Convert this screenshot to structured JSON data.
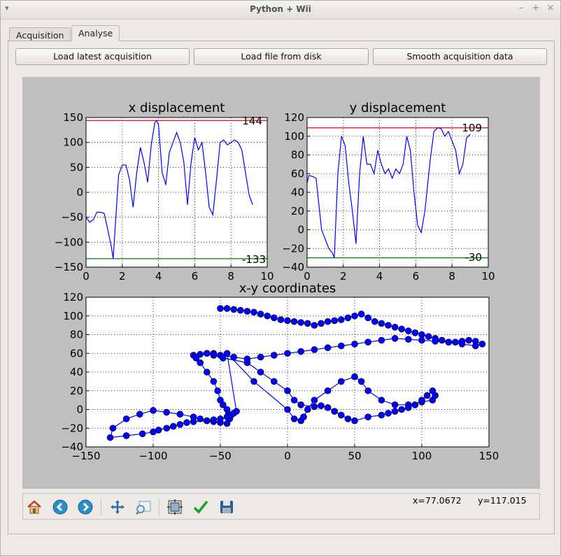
{
  "window": {
    "title": "Python + Wii"
  },
  "tabs": [
    {
      "label": "Acquisition"
    },
    {
      "label": "Analyse"
    }
  ],
  "buttons": {
    "load_latest": "Load latest acquisition",
    "load_file": "Load file from disk",
    "smooth": "Smooth acquisition data"
  },
  "toolbar": {
    "icons": [
      "home-icon",
      "back-icon",
      "forward-icon",
      "pan-icon",
      "zoom-icon",
      "subplots-icon",
      "edit-curves-icon",
      "save-icon"
    ]
  },
  "status": {
    "x": "x=77.0672",
    "y": "y=117.015"
  },
  "colors": {
    "line": "#0000ff",
    "max_line": "#ff0000",
    "min_line": "#008000",
    "marker": "#0000ff",
    "figure_bg": "#bfbfbf"
  },
  "chart_data": [
    {
      "type": "line",
      "title": "x displacement",
      "xlim": [
        0,
        10
      ],
      "ylim": [
        -150,
        150
      ],
      "xticks": [
        "0",
        "2",
        "4",
        "6",
        "8",
        "10"
      ],
      "yticks": [
        "−150",
        "−100",
        "−50",
        "0",
        "50",
        "100",
        "150"
      ],
      "grid": true,
      "max_label": "144",
      "max_value": 144,
      "min_label": "-133",
      "min_value": -133,
      "x": [
        0,
        0.2,
        0.4,
        0.6,
        0.8,
        1.0,
        1.2,
        1.4,
        1.5,
        1.7,
        1.8,
        2.0,
        2.2,
        2.4,
        2.6,
        2.8,
        3.0,
        3.2,
        3.4,
        3.6,
        3.8,
        3.9,
        4.0,
        4.2,
        4.4,
        4.6,
        4.8,
        5.0,
        5.2,
        5.4,
        5.6,
        5.8,
        6.0,
        6.2,
        6.4,
        6.6,
        6.8,
        7.0,
        7.2,
        7.4,
        7.6,
        7.8,
        8.0,
        8.2,
        8.4,
        8.6,
        8.8,
        9.0,
        9.2
      ],
      "y": [
        -50,
        -60,
        -55,
        -40,
        -40,
        -42,
        -75,
        -110,
        -133,
        -20,
        35,
        55,
        55,
        25,
        -30,
        40,
        90,
        60,
        20,
        95,
        140,
        144,
        135,
        40,
        15,
        80,
        100,
        120,
        100,
        60,
        -25,
        60,
        110,
        85,
        100,
        40,
        -30,
        -45,
        25,
        100,
        105,
        95,
        100,
        105,
        100,
        85,
        40,
        -5,
        -25
      ]
    },
    {
      "type": "line",
      "title": "y displacement",
      "xlim": [
        0,
        10
      ],
      "ylim": [
        -40,
        120
      ],
      "xticks": [
        "0",
        "2",
        "4",
        "6",
        "8",
        "10"
      ],
      "yticks": [
        "−40",
        "−20",
        "0",
        "20",
        "40",
        "60",
        "80",
        "100",
        "120"
      ],
      "grid": true,
      "max_label": "109",
      "max_value": 109,
      "min_label": "-30",
      "min_value": -30,
      "x": [
        0,
        0.1,
        0.3,
        0.5,
        0.8,
        1.0,
        1.2,
        1.4,
        1.5,
        1.7,
        1.9,
        2.1,
        2.3,
        2.5,
        2.7,
        2.9,
        3.1,
        3.3,
        3.5,
        3.7,
        3.9,
        4.1,
        4.3,
        4.5,
        4.7,
        4.9,
        5.1,
        5.3,
        5.5,
        5.7,
        5.9,
        6.1,
        6.3,
        6.5,
        6.8,
        7.0,
        7.2,
        7.4,
        7.6,
        7.8,
        8.0,
        8.2,
        8.4,
        8.6,
        8.8,
        9.0
      ],
      "y": [
        50,
        58,
        57,
        55,
        0,
        -10,
        -20,
        -25,
        -30,
        60,
        100,
        90,
        50,
        20,
        -15,
        60,
        100,
        70,
        70,
        60,
        85,
        70,
        60,
        65,
        55,
        65,
        60,
        70,
        100,
        85,
        40,
        5,
        -3,
        20,
        75,
        105,
        109,
        108,
        100,
        105,
        95,
        85,
        60,
        70,
        98,
        102
      ]
    },
    {
      "type": "scatter",
      "title": "x-y coordinates",
      "xlim": [
        -150,
        150
      ],
      "ylim": [
        -40,
        120
      ],
      "xticks": [
        "−150",
        "−100",
        "−50",
        "0",
        "50",
        "100",
        "150"
      ],
      "yticks": [
        "−40",
        "−20",
        "0",
        "20",
        "40",
        "60",
        "80",
        "100",
        "120"
      ],
      "grid": true,
      "x": [
        -50,
        -45,
        -40,
        -35,
        -30,
        -25,
        -20,
        -15,
        -10,
        -5,
        0,
        5,
        10,
        15,
        20,
        25,
        30,
        35,
        40,
        45,
        50,
        55,
        60,
        65,
        70,
        75,
        80,
        85,
        90,
        95,
        100,
        105,
        110,
        115,
        120,
        125,
        130,
        135,
        140,
        145,
        140,
        130,
        120,
        110,
        100,
        90,
        80,
        70,
        60,
        50,
        40,
        30,
        20,
        10,
        0,
        -10,
        -20,
        -30,
        -40,
        -50,
        -55,
        -60,
        -65,
        -70,
        -68,
        -65,
        -60,
        -55,
        -52,
        -50,
        -48,
        -45,
        -44,
        -43,
        -45,
        -50,
        -55,
        -60,
        -65,
        -70,
        -80,
        -90,
        -100,
        -110,
        -120,
        -130,
        -132,
        -120,
        -108,
        -100,
        -96,
        -90,
        -85,
        -80,
        -75,
        -70,
        -60,
        -55,
        -50,
        -45,
        -42,
        -40,
        -38,
        -45,
        -25,
        0,
        5,
        10,
        12,
        15,
        20,
        30,
        40,
        50,
        55,
        60,
        70,
        80,
        90,
        100,
        108,
        110,
        108,
        104,
        100,
        95,
        90,
        85,
        80,
        75,
        70,
        60,
        50,
        45,
        40,
        35,
        30,
        25,
        20,
        10,
        5,
        0,
        -10,
        -20,
        -30,
        -48,
        -55,
        -60
      ],
      "y": [
        108,
        108,
        107,
        106,
        105,
        104,
        102,
        100,
        98,
        96,
        95,
        94,
        93,
        92,
        90,
        92,
        94,
        95,
        96,
        98,
        100,
        102,
        98,
        94,
        92,
        90,
        88,
        86,
        84,
        82,
        80,
        78,
        76,
        74,
        72,
        72,
        73,
        74,
        73,
        70,
        68,
        70,
        72,
        73,
        74,
        75,
        76,
        74,
        72,
        70,
        68,
        66,
        64,
        62,
        60,
        58,
        56,
        54,
        56,
        58,
        60,
        60,
        59,
        58,
        55,
        50,
        40,
        30,
        20,
        10,
        5,
        0,
        -5,
        -10,
        -15,
        -14,
        -13,
        -12,
        -10,
        -8,
        -5,
        -3,
        -1,
        -5,
        -10,
        -20,
        -30,
        -28,
        -26,
        -24,
        -22,
        -20,
        -18,
        -16,
        -14,
        -13,
        -12,
        -11,
        -10,
        -8,
        -6,
        -4,
        -2,
        60,
        30,
        0,
        -10,
        -12,
        -8,
        0,
        10,
        20,
        30,
        35,
        30,
        20,
        10,
        5,
        5,
        8,
        10,
        15,
        20,
        15,
        10,
        5,
        2,
        0,
        -2,
        -4,
        -6,
        -8,
        -12,
        -10,
        -6,
        -2,
        2,
        4,
        3,
        5,
        10,
        20,
        30,
        40,
        50,
        55,
        58,
        60
      ]
    }
  ]
}
